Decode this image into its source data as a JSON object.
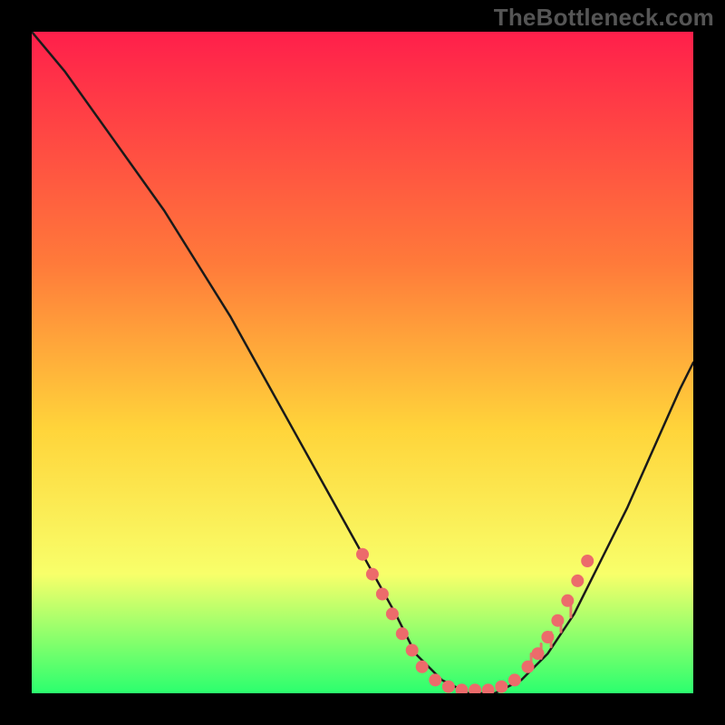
{
  "watermark": "TheBottleneck.com",
  "colors": {
    "bg": "#000000",
    "curve": "#1a1a1a",
    "dots": "#ec6b6b",
    "ticks": "#ec6b6b",
    "gradient_top": "#ff1f4b",
    "gradient_mid1": "#ff7a3a",
    "gradient_mid2": "#ffd43a",
    "gradient_mid3": "#f8ff6a",
    "gradient_bottom": "#2bff6e"
  },
  "chart_data": {
    "type": "line",
    "title": "",
    "xlabel": "",
    "ylabel": "",
    "xlim": [
      0,
      100
    ],
    "ylim": [
      0,
      100
    ],
    "grid": false,
    "legend": false,
    "series": [
      {
        "name": "curve",
        "x": [
          0,
          5,
          10,
          15,
          20,
          25,
          30,
          35,
          40,
          45,
          50,
          55,
          58,
          62,
          66,
          70,
          74,
          78,
          82,
          86,
          90,
          94,
          98,
          100
        ],
        "y": [
          100,
          94,
          87,
          80,
          73,
          65,
          57,
          48,
          39,
          30,
          21,
          12,
          6,
          2,
          0,
          0,
          2,
          6,
          12,
          20,
          28,
          37,
          46,
          50
        ]
      }
    ],
    "highlight_clusters": [
      {
        "name": "left-valley-dots",
        "points": [
          {
            "x": 50,
            "y": 21
          },
          {
            "x": 51.5,
            "y": 18
          },
          {
            "x": 53,
            "y": 15
          },
          {
            "x": 54.5,
            "y": 12
          },
          {
            "x": 56,
            "y": 9
          },
          {
            "x": 57.5,
            "y": 6.5
          },
          {
            "x": 59,
            "y": 4
          }
        ]
      },
      {
        "name": "bottom-dots",
        "points": [
          {
            "x": 61,
            "y": 2
          },
          {
            "x": 63,
            "y": 1
          },
          {
            "x": 65,
            "y": 0.5
          },
          {
            "x": 67,
            "y": 0.5
          },
          {
            "x": 69,
            "y": 0.5
          },
          {
            "x": 71,
            "y": 1
          },
          {
            "x": 73,
            "y": 2
          }
        ]
      },
      {
        "name": "right-valley-dots",
        "points": [
          {
            "x": 75,
            "y": 4
          },
          {
            "x": 76.5,
            "y": 6
          },
          {
            "x": 78,
            "y": 8.5
          },
          {
            "x": 79.5,
            "y": 11
          },
          {
            "x": 81,
            "y": 14
          },
          {
            "x": 82.5,
            "y": 17
          },
          {
            "x": 84,
            "y": 20
          }
        ]
      }
    ],
    "right_ticks_x": [
      75.5,
      77,
      78.5,
      80,
      81.5
    ]
  }
}
